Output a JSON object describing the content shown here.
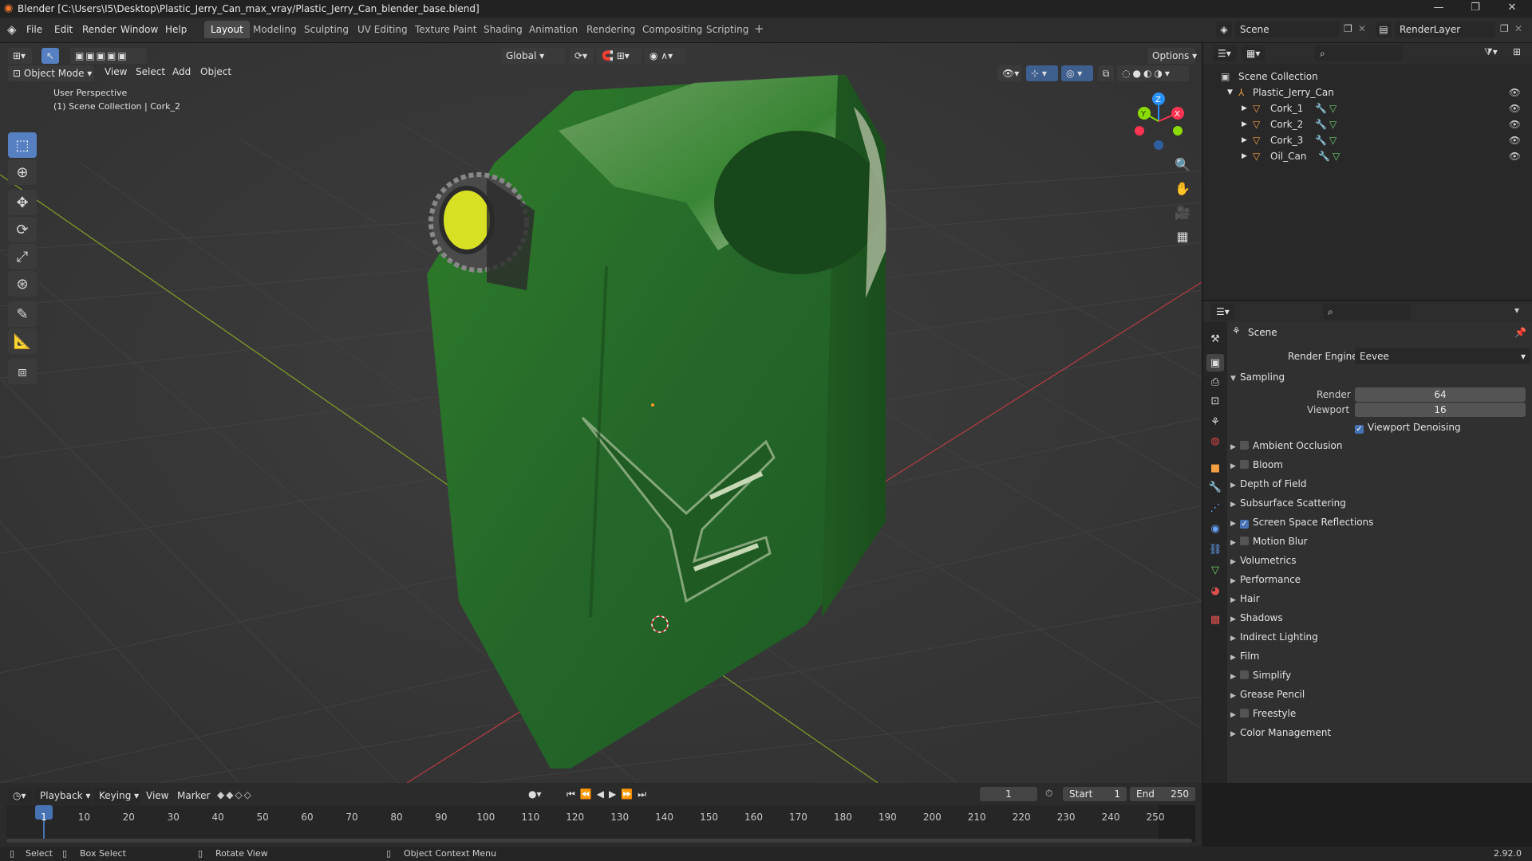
{
  "title": "Blender [C:\\Users\\I5\\Desktop\\Plastic_Jerry_Can_max_vray/Plastic_Jerry_Can_blender_base.blend]",
  "menus": [
    "File",
    "Edit",
    "Render",
    "Window",
    "Help"
  ],
  "workspaces": [
    "Layout",
    "Modeling",
    "Sculpting",
    "UV Editing",
    "Texture Paint",
    "Shading",
    "Animation",
    "Rendering",
    "Compositing",
    "Scripting"
  ],
  "scene": {
    "label": "Scene",
    "render_layer": "RenderLayer"
  },
  "viewport": {
    "transform": "Global",
    "options": "Options",
    "mode": "Object Mode",
    "menu": [
      "View",
      "Select",
      "Add",
      "Object"
    ],
    "overlay_line1": "User Perspective",
    "overlay_line2": "(1) Scene Collection | Cork_2",
    "gizmo": {
      "x": "X",
      "y": "Y",
      "z": "Z"
    }
  },
  "outliner": {
    "root": "Scene Collection",
    "collection": "Plastic_Jerry_Can",
    "items": [
      "Cork_1",
      "Cork_2",
      "Cork_3",
      "Oil_Can"
    ]
  },
  "properties": {
    "context": "Scene",
    "render_engine_label": "Render Engine",
    "render_engine": "Eevee",
    "sampling": {
      "label": "Sampling",
      "render_label": "Render",
      "render": "64",
      "viewport_label": "Viewport",
      "viewport": "16",
      "denoise": "Viewport Denoising"
    },
    "sections": [
      {
        "label": "Ambient Occlusion",
        "checkbox": true,
        "checked": false
      },
      {
        "label": "Bloom",
        "checkbox": true,
        "checked": false
      },
      {
        "label": "Depth of Field",
        "checkbox": false
      },
      {
        "label": "Subsurface Scattering",
        "checkbox": false
      },
      {
        "label": "Screen Space Reflections",
        "checkbox": true,
        "checked": true
      },
      {
        "label": "Motion Blur",
        "checkbox": true,
        "checked": false
      },
      {
        "label": "Volumetrics",
        "checkbox": false
      },
      {
        "label": "Performance",
        "checkbox": false
      },
      {
        "label": "Hair",
        "checkbox": false
      },
      {
        "label": "Shadows",
        "checkbox": false
      },
      {
        "label": "Indirect Lighting",
        "checkbox": false
      },
      {
        "label": "Film",
        "checkbox": false
      },
      {
        "label": "Simplify",
        "checkbox": true,
        "checked": false
      },
      {
        "label": "Grease Pencil",
        "checkbox": false
      },
      {
        "label": "Freestyle",
        "checkbox": true,
        "checked": false
      },
      {
        "label": "Color Management",
        "checkbox": false
      }
    ]
  },
  "timeline": {
    "menus": [
      "Playback",
      "Keying",
      "View",
      "Marker"
    ],
    "current_frame": "1",
    "start_label": "Start",
    "start": "1",
    "end_label": "End",
    "end": "250",
    "ticks": [
      "1",
      "10",
      "20",
      "30",
      "40",
      "50",
      "60",
      "70",
      "80",
      "90",
      "100",
      "110",
      "120",
      "130",
      "140",
      "150",
      "160",
      "170",
      "180",
      "190",
      "200",
      "210",
      "220",
      "230",
      "240",
      "250"
    ]
  },
  "statusbar": {
    "select": "Select",
    "box_select": "Box Select",
    "rotate": "Rotate View",
    "context_menu": "Object Context Menu",
    "version": "2.92.0"
  },
  "colors": {
    "accent": "#4772b3",
    "active_tool": "#5680c2",
    "x_axis": "#ff3352",
    "y_axis": "#8bdc00",
    "z_axis": "#2890ff",
    "mesh": "#2e7a2a"
  }
}
